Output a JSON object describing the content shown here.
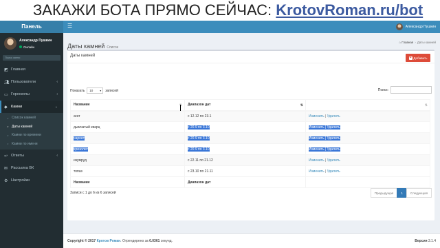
{
  "promo": {
    "text": "ЗАКАЖИ БОТА ПРЯМО СЕЙЧАС: ",
    "link": "KrotovRoman.ru/bot"
  },
  "header": {
    "logo": "Панель",
    "toggle_icon": "bars-icon",
    "user_name": "Александр Пушкин"
  },
  "sidebar": {
    "user": {
      "name": "Александр Пушкин",
      "status": "Онлайн"
    },
    "search_placeholder": "Поиск меню",
    "items": [
      {
        "label": "Главная",
        "icon": "dashboard-icon"
      },
      {
        "label": "Пользователи",
        "icon": "users-icon"
      },
      {
        "label": "Гороскопы",
        "icon": "folder-icon"
      },
      {
        "label": "Камни",
        "icon": "gem-icon"
      },
      {
        "label": "Ответы",
        "icon": "reply-icon"
      },
      {
        "label": "Рассылка ВК",
        "icon": "vk-icon"
      },
      {
        "label": "Настройки",
        "icon": "gear-icon"
      }
    ],
    "submenu": [
      {
        "label": "Список камней"
      },
      {
        "label": "Даты камней"
      },
      {
        "label": "Камни по времени"
      },
      {
        "label": "Камни по имени"
      }
    ]
  },
  "page": {
    "title": "Даты камней",
    "subtitle": "Список"
  },
  "breadcrumb": {
    "home": "Главная",
    "current": "Даты камней"
  },
  "box": {
    "title": "Даты камней",
    "add_button": "Добавить",
    "length_label": "Показать",
    "length_value": "10",
    "length_suffix": "записей",
    "search_label": "Поиск:",
    "columns": [
      "Название",
      "Диапазон дат",
      ""
    ],
    "rows": [
      {
        "name": "агат",
        "range": "с 12.12 по 23.1",
        "edit": "Изменить",
        "del": "Удалить"
      },
      {
        "name": "дымчатый кварц",
        "range": "с 20.9 по 3.10",
        "edit": "Изменить",
        "del": "Удалить"
      },
      {
        "name": "чароит",
        "range": "с 20.9 по 3.10",
        "edit": "Изменить",
        "del": "Удалить"
      },
      {
        "name": "хризолит",
        "range": "с 20.9 по 3.10",
        "edit": "Изменить",
        "del": "Удалить"
      },
      {
        "name": "изумруд",
        "range": "с 22.11 по 21.12",
        "edit": "Изменить",
        "del": "Удалить"
      },
      {
        "name": "топаз",
        "range": "с 23.10 по 21.11",
        "edit": "Изменить",
        "del": "Удалить"
      }
    ],
    "info": "Записи с 1 до 6 из 6 записей",
    "pager": {
      "prev": "Предыдущая",
      "current": "1",
      "next": "Следующая"
    }
  },
  "footer": {
    "copyright": "Copyright © 2017 ",
    "author": "Кротов Роман",
    "rendered": ". Отрендерено за ",
    "time": "0.0361",
    "seconds": " секунд.",
    "version_label": "Версия",
    "version": "3.1.4"
  }
}
